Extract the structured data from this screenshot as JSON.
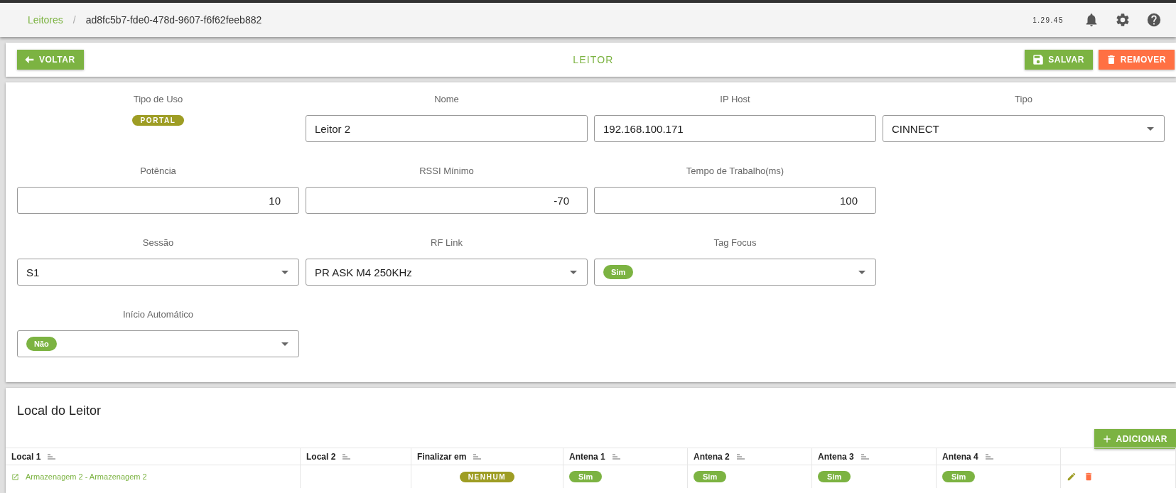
{
  "breadcrumb": {
    "items": [
      {
        "label": "Leitores",
        "kind": "link"
      },
      {
        "label": "/",
        "kind": "separator"
      },
      {
        "label": "ad8fc5b7-fde0-478d-9607-f6f62feeb882",
        "kind": "current"
      }
    ],
    "version": "1.29.45"
  },
  "toolbar": {
    "back": "VOLTAR",
    "title": "LEITOR",
    "save": "SALVAR",
    "remove": "REMOVER"
  },
  "form": {
    "rows": [
      [
        {
          "label": "Tipo de Uso",
          "kind": "badge",
          "value": "PORTAL"
        },
        {
          "label": "Nome",
          "kind": "text",
          "value": "Leitor 2"
        },
        {
          "label": "IP Host",
          "kind": "text",
          "value": "192.168.100.171"
        },
        {
          "label": "Tipo",
          "kind": "select",
          "value": "CINNECT"
        }
      ],
      [
        {
          "label": "Potência",
          "kind": "number",
          "value": "10"
        },
        {
          "label": "RSSI Mínimo",
          "kind": "number",
          "value": "-70"
        },
        {
          "label": "Tempo de Trabalho(ms)",
          "kind": "number",
          "value": "100"
        }
      ],
      [
        {
          "label": "Sessão",
          "kind": "select",
          "value": "S1"
        },
        {
          "label": "RF Link",
          "kind": "select",
          "value": "PR ASK M4 250KHz"
        },
        {
          "label": "Tag Focus",
          "kind": "chip-select",
          "value": "Sim"
        }
      ],
      [
        {
          "label": "Início Automático",
          "kind": "chip-select",
          "value": "Não"
        }
      ]
    ]
  },
  "locations": {
    "title": "Local do Leitor",
    "add": "ADICIONAR",
    "columns": [
      "Local 1",
      "Local 2",
      "Finalizar em",
      "Antena 1",
      "Antena 2",
      "Antena 3",
      "Antena 4"
    ],
    "rows": [
      {
        "cells": [
          {
            "kind": "link",
            "value": "Armazenagem 2 - Armazenagem 2"
          },
          {
            "kind": "empty"
          },
          {
            "kind": "badge",
            "value": "NENHUM"
          },
          {
            "kind": "chip",
            "value": "Sim"
          },
          {
            "kind": "chip",
            "value": "Sim"
          },
          {
            "kind": "chip",
            "value": "Sim"
          },
          {
            "kind": "chip",
            "value": "Sim"
          }
        ]
      }
    ]
  }
}
